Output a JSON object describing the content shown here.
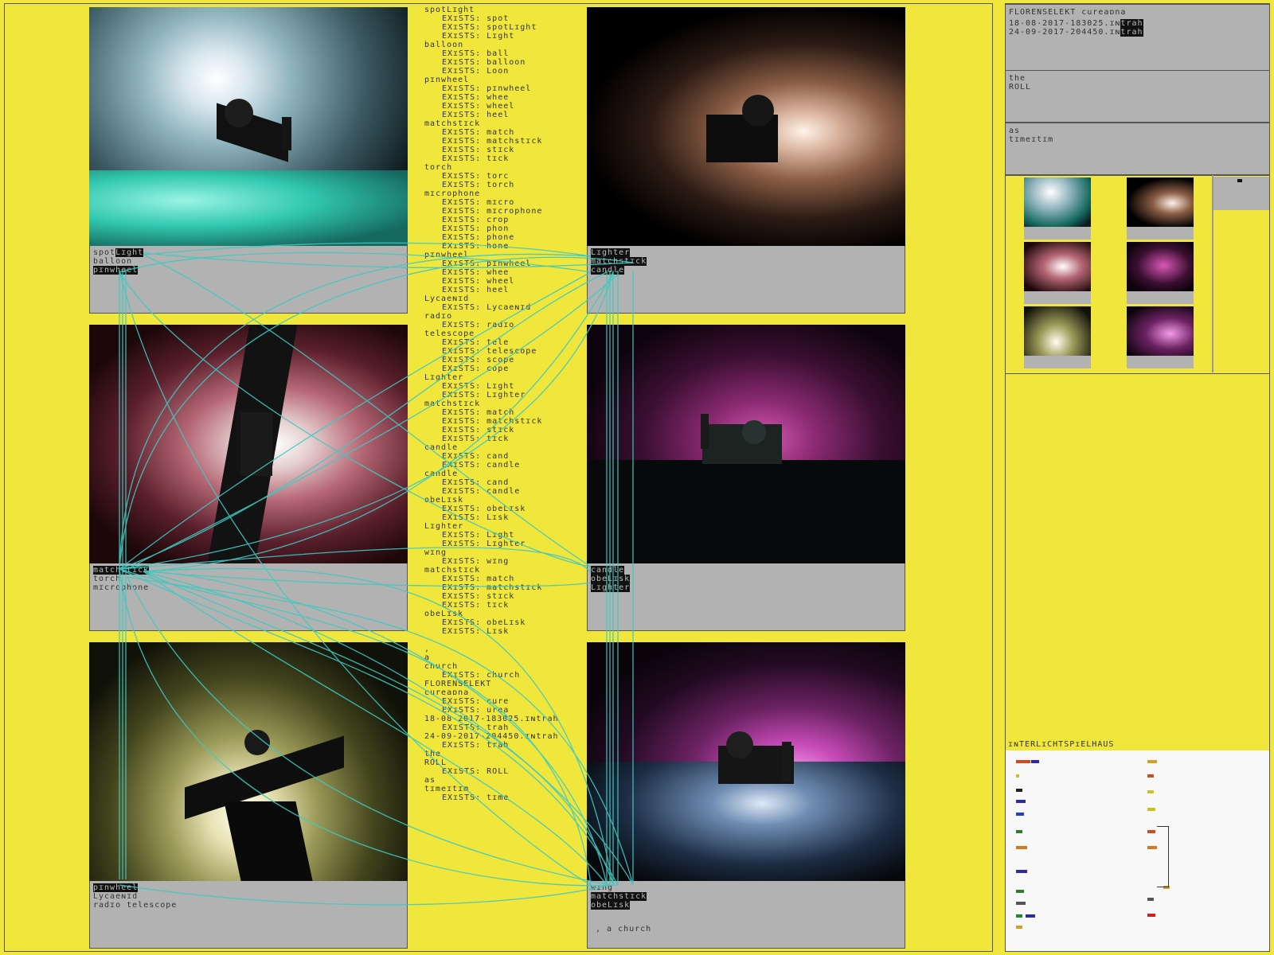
{
  "panels": [
    {
      "caption": [
        {
          "parts": [
            {
              "t": "spot",
              "hl": false
            },
            {
              "t": "Lɪght",
              "hl": true
            }
          ]
        },
        {
          "parts": [
            {
              "t": "balloon",
              "hl": false
            }
          ]
        },
        {
          "parts": [
            {
              "t": "pɪnwheel",
              "hl": true
            }
          ]
        }
      ]
    },
    {
      "caption": [
        {
          "parts": [
            {
              "t": "Lɪghter",
              "hl": true
            }
          ]
        },
        {
          "parts": [
            {
              "t": "matchstɪck",
              "hl": true
            }
          ]
        },
        {
          "parts": [
            {
              "t": "candle",
              "hl": true
            }
          ]
        }
      ]
    },
    {
      "caption": [
        {
          "parts": [
            {
              "t": "matchstɪck",
              "hl": true
            }
          ]
        },
        {
          "parts": [
            {
              "t": "torch",
              "hl": false
            }
          ]
        },
        {
          "parts": [
            {
              "t": "mɪcrophone",
              "hl": false
            }
          ]
        }
      ]
    },
    {
      "caption": [
        {
          "parts": [
            {
              "t": "candle",
              "hl": true
            }
          ]
        },
        {
          "parts": [
            {
              "t": "obeLɪsk",
              "hl": true
            }
          ]
        },
        {
          "parts": [
            {
              "t": "Lɪghter",
              "hl": true
            }
          ]
        }
      ]
    },
    {
      "caption": [
        {
          "parts": [
            {
              "t": "pɪnwheel",
              "hl": true
            }
          ]
        },
        {
          "parts": [
            {
              "t": "Lycaeɴɪd",
              "hl": false
            }
          ]
        },
        {
          "parts": [
            {
              "t": "radɪo telescope",
              "hl": false
            }
          ]
        }
      ]
    },
    {
      "caption": [
        {
          "parts": [
            {
              "t": "wɪng",
              "hl": false
            }
          ]
        },
        {
          "parts": [
            {
              "t": "matchstɪck",
              "hl": true
            }
          ]
        },
        {
          "parts": [
            {
              "t": "obeLɪsk",
              "hl": true
            }
          ]
        }
      ],
      "note": ", a church"
    }
  ],
  "word_list": [
    {
      "t": "spotLɪght",
      "sub": false
    },
    {
      "t": "EXɪSTS: spot",
      "sub": true
    },
    {
      "t": "EXɪSTS: spotLɪght",
      "sub": true
    },
    {
      "t": "EXɪSTS: Lɪght",
      "sub": true
    },
    {
      "t": "balloon",
      "sub": false
    },
    {
      "t": "EXɪSTS: ball",
      "sub": true
    },
    {
      "t": "EXɪSTS: balloon",
      "sub": true
    },
    {
      "t": "EXɪSTS: Loon",
      "sub": true
    },
    {
      "t": "pɪnwheel",
      "sub": false
    },
    {
      "t": "EXɪSTS: pɪnwheel",
      "sub": true
    },
    {
      "t": "EXɪSTS: whee",
      "sub": true
    },
    {
      "t": "EXɪSTS: wheel",
      "sub": true
    },
    {
      "t": "EXɪSTS: heel",
      "sub": true
    },
    {
      "t": "matchstɪck",
      "sub": false
    },
    {
      "t": "EXɪSTS: match",
      "sub": true
    },
    {
      "t": "EXɪSTS: matchstɪck",
      "sub": true
    },
    {
      "t": "EXɪSTS: stɪck",
      "sub": true
    },
    {
      "t": "EXɪSTS: tɪck",
      "sub": true
    },
    {
      "t": "torch",
      "sub": false
    },
    {
      "t": "EXɪSTS: torc",
      "sub": true
    },
    {
      "t": "EXɪSTS: torch",
      "sub": true
    },
    {
      "t": "mɪcrophone",
      "sub": false
    },
    {
      "t": "EXɪSTS: mɪcro",
      "sub": true
    },
    {
      "t": "EXɪSTS: mɪcrophone",
      "sub": true
    },
    {
      "t": "EXɪSTS: crop",
      "sub": true
    },
    {
      "t": "EXɪSTS: phon",
      "sub": true
    },
    {
      "t": "EXɪSTS: phone",
      "sub": true
    },
    {
      "t": "EXɪSTS: hone",
      "sub": true
    },
    {
      "t": "pɪnwheel",
      "sub": false
    },
    {
      "t": "EXɪSTS: pɪnwheel",
      "sub": true
    },
    {
      "t": "EXɪSTS: whee",
      "sub": true
    },
    {
      "t": "EXɪSTS: wheel",
      "sub": true
    },
    {
      "t": "EXɪSTS: heel",
      "sub": true
    },
    {
      "t": "Lycaeɴɪd",
      "sub": false
    },
    {
      "t": "EXɪSTS: Lycaeɴɪd",
      "sub": true
    },
    {
      "t": "radɪo",
      "sub": false
    },
    {
      "t": "EXɪSTS: radɪo",
      "sub": true
    },
    {
      "t": "telescope",
      "sub": false
    },
    {
      "t": "EXɪSTS: tele",
      "sub": true
    },
    {
      "t": "EXɪSTS: telescope",
      "sub": true
    },
    {
      "t": "EXɪSTS: scope",
      "sub": true
    },
    {
      "t": "EXɪSTS: cope",
      "sub": true
    },
    {
      "t": "Lɪghter",
      "sub": false
    },
    {
      "t": "EXɪSTS: Lɪght",
      "sub": true
    },
    {
      "t": "EXɪSTS: Lɪghter",
      "sub": true
    },
    {
      "t": "matchstɪck",
      "sub": false
    },
    {
      "t": "EXɪSTS: match",
      "sub": true
    },
    {
      "t": "EXɪSTS: matchstɪck",
      "sub": true
    },
    {
      "t": "EXɪSTS: stɪck",
      "sub": true
    },
    {
      "t": "EXɪSTS: tɪck",
      "sub": true
    },
    {
      "t": "candle",
      "sub": false
    },
    {
      "t": "EXɪSTS: cand",
      "sub": true
    },
    {
      "t": "EXɪSTS: candle",
      "sub": true
    },
    {
      "t": "candle",
      "sub": false
    },
    {
      "t": "EXɪSTS: cand",
      "sub": true
    },
    {
      "t": "EXɪSTS: candle",
      "sub": true
    },
    {
      "t": "obeLɪsk",
      "sub": false
    },
    {
      "t": "EXɪSTS: obeLɪsk",
      "sub": true
    },
    {
      "t": "EXɪSTS: Lɪsk",
      "sub": true
    },
    {
      "t": "Lɪghter",
      "sub": false
    },
    {
      "t": "EXɪSTS: Lɪght",
      "sub": true
    },
    {
      "t": "EXɪSTS: Lɪghter",
      "sub": true
    },
    {
      "t": "wɪng",
      "sub": false
    },
    {
      "t": "EXɪSTS: wɪng",
      "sub": true
    },
    {
      "t": "matchstɪck",
      "sub": false
    },
    {
      "t": "EXɪSTS: match",
      "sub": true
    },
    {
      "t": "EXɪSTS: matchstɪck",
      "sub": true
    },
    {
      "t": "EXɪSTS: stɪck",
      "sub": true
    },
    {
      "t": "EXɪSTS: tɪck",
      "sub": true
    },
    {
      "t": "obeLɪsk",
      "sub": false
    },
    {
      "t": "EXɪSTS: obeLɪsk",
      "sub": true
    },
    {
      "t": "EXɪSTS: Lɪsk",
      "sub": true
    },
    {
      "t": "",
      "sub": false
    },
    {
      "t": ",",
      "sub": false
    },
    {
      "t": "a",
      "sub": false
    },
    {
      "t": "church",
      "sub": false
    },
    {
      "t": "EXɪSTS: church",
      "sub": true
    },
    {
      "t": "FLORENSELEKT",
      "sub": false
    },
    {
      "t": "cureaɒna",
      "sub": false
    },
    {
      "t": "EXɪSTS: cure",
      "sub": true
    },
    {
      "t": "EXɪSTS: urea",
      "sub": true
    },
    {
      "t": "18-08-2017-183025.ɪɴtrah",
      "sub": false
    },
    {
      "t": "EXɪSTS: trah",
      "sub": true
    },
    {
      "t": "24-09-2017-204450.ɪɴtrah",
      "sub": false
    },
    {
      "t": "EXɪSTS: trah",
      "sub": true
    },
    {
      "t": "the",
      "sub": false
    },
    {
      "t": "ROLL",
      "sub": false
    },
    {
      "t": "EXɪSTS: ROLL",
      "sub": true
    },
    {
      "t": "as",
      "sub": false
    },
    {
      "t": "tɪmeɪtɪm",
      "sub": false
    },
    {
      "t": "EXɪSTS: tɪme",
      "sub": true
    }
  ],
  "sidebar": {
    "header_title": "FLORENSELEKT cureaɒna",
    "files": [
      {
        "name": "18-08-2017-183025.ɪɴ",
        "hl": "trah"
      },
      {
        "name": "24-09-2017-204450.ɪɴ",
        "hl": "trah"
      }
    ],
    "box2": [
      "the",
      "ROLL"
    ],
    "box3": [
      "as",
      "tɪmeɪtɪm"
    ],
    "inter_title": "ɪɴTERLɪCHTSPɪELHAUS"
  },
  "colors": {
    "background": "#f0e63c",
    "caption_bg": "#b2b2b2",
    "connector": "#3fc9c0",
    "highlight_bg": "#111111"
  }
}
